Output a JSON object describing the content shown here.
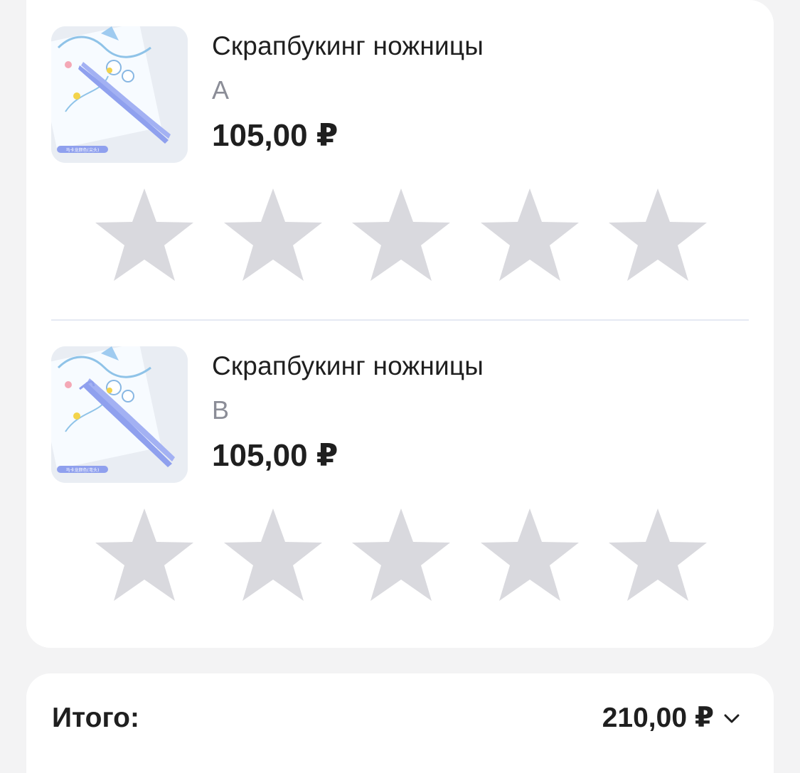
{
  "items": [
    {
      "title": "Скрапбукинг ножницы",
      "variant": "A",
      "price": "105,00 ₽",
      "image_caption": "马卡龙颜色(尖头)",
      "rating": 0,
      "rating_max": 5
    },
    {
      "title": "Скрапбукинг ножницы",
      "variant": "B",
      "price": "105,00 ₽",
      "image_caption": "马卡龙颜色(弯头)",
      "rating": 0,
      "rating_max": 5
    }
  ],
  "summary": {
    "label": "Итого:",
    "value": "210,00 ₽"
  },
  "colors": {
    "background": "#f3f3f4",
    "card": "#ffffff",
    "text": "#1f1f1f",
    "muted_text": "#8b8d97",
    "star_empty": "#d9d9de",
    "divider": "#e5e9f3",
    "tweezer": "#8fa0ee"
  },
  "icons": {
    "rating_star": "star-icon",
    "expand": "chevron-down-icon"
  }
}
